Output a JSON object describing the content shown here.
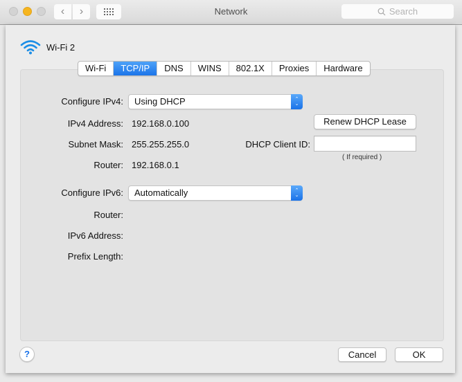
{
  "window": {
    "title": "Network",
    "search_placeholder": "Search",
    "icons": {
      "back": "chevron-left-icon",
      "forward": "chevron-right-icon",
      "show_all": "grid-icon",
      "search": "magnifier-icon"
    }
  },
  "interface": {
    "name": "Wi-Fi 2",
    "icon": "wifi-icon",
    "accent_color": "#1b74e9"
  },
  "tabs": [
    {
      "label": "Wi-Fi",
      "active": false
    },
    {
      "label": "TCP/IP",
      "active": true
    },
    {
      "label": "DNS",
      "active": false
    },
    {
      "label": "WINS",
      "active": false
    },
    {
      "label": "802.1X",
      "active": false
    },
    {
      "label": "Proxies",
      "active": false
    },
    {
      "label": "Hardware",
      "active": false
    }
  ],
  "ipv4": {
    "configure_label": "Configure IPv4:",
    "configure_value": "Using DHCP",
    "address_label": "IPv4 Address:",
    "address_value": "192.168.0.100",
    "subnet_label": "Subnet Mask:",
    "subnet_value": "255.255.255.0",
    "router_label": "Router:",
    "router_value": "192.168.0.1",
    "renew_button": "Renew DHCP Lease",
    "client_id_label": "DHCP Client ID:",
    "client_id_value": "",
    "client_id_hint": "( If required )"
  },
  "ipv6": {
    "configure_label": "Configure IPv6:",
    "configure_value": "Automatically",
    "router_label": "Router:",
    "router_value": "",
    "address_label": "IPv6 Address:",
    "address_value": "",
    "prefix_label": "Prefix Length:",
    "prefix_value": ""
  },
  "footer": {
    "help_label": "?",
    "cancel_label": "Cancel",
    "ok_label": "OK"
  }
}
